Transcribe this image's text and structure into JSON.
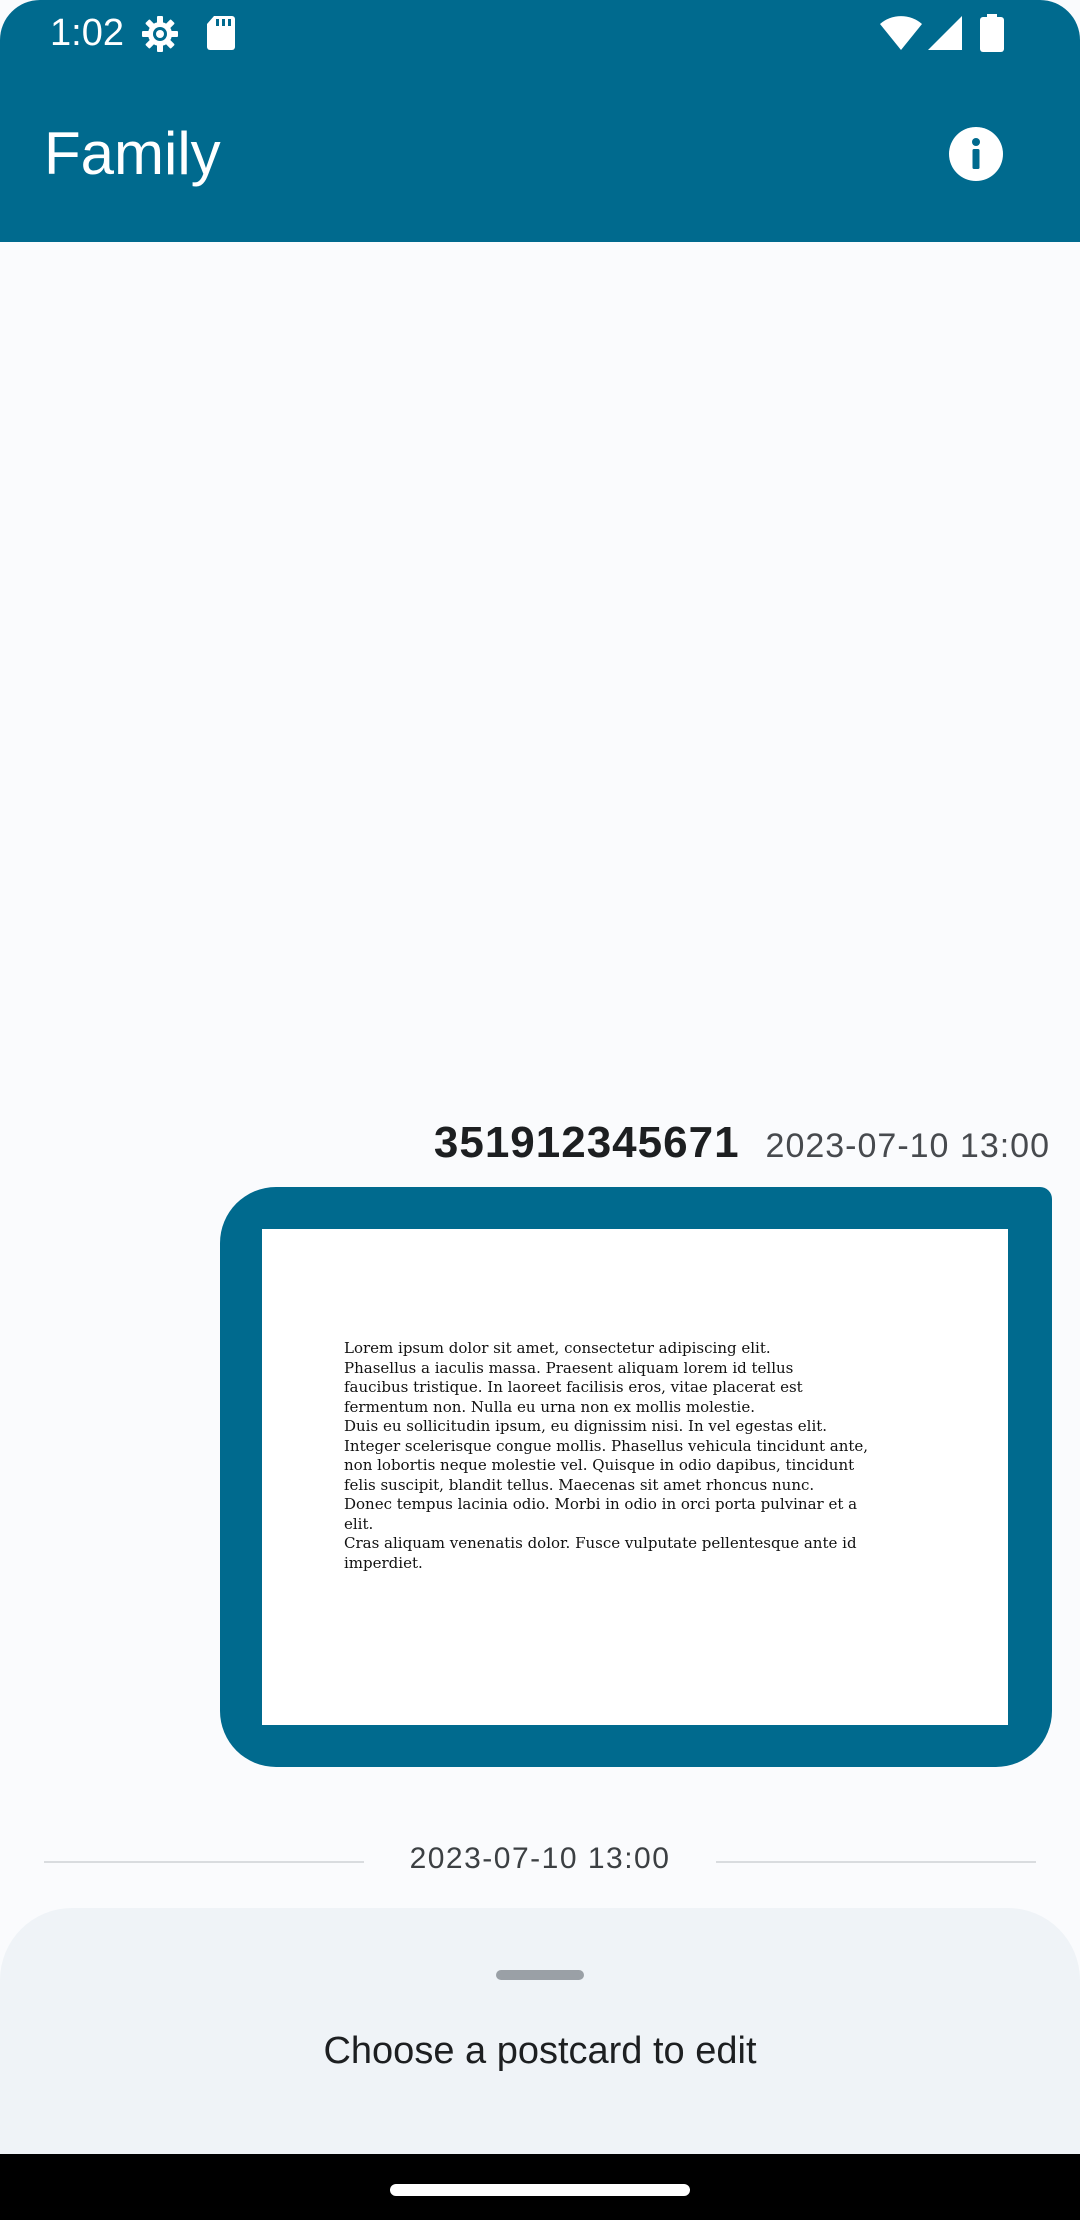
{
  "status_bar": {
    "time": "1:02",
    "icons": [
      "settings-gear-icon",
      "sd-card-icon",
      "wifi-icon",
      "signal-icon",
      "battery-icon"
    ]
  },
  "app_bar": {
    "title": "Family",
    "info_icon": "info-icon",
    "color": "#006a8e"
  },
  "message": {
    "sender": "351912345671",
    "timestamp": "2023-07-10 13:00",
    "postcard_text": [
      "Lorem ipsum dolor sit amet, consectetur adipiscing elit.",
      "Phasellus a iaculis massa. Praesent aliquam lorem id tellus",
      "faucibus tristique. In laoreet facilisis eros, vitae placerat est",
      "fermentum non. Nulla eu urna non ex mollis molestie.",
      "Duis eu sollicitudin ipsum, eu dignissim nisi. In vel egestas elit.",
      "Integer scelerisque congue mollis. Phasellus vehicula tincidunt ante,",
      "non lobortis neque molestie vel. Quisque in odio dapibus, tincidunt",
      "felis suscipit, blandit tellus. Maecenas sit amet rhoncus nunc.",
      "Donec tempus lacinia odio. Morbi in odio in orci porta pulvinar et a",
      "elit.",
      "Cras aliquam venenatis dolor. Fusce vulputate pellentesque ante id",
      "imperdiet."
    ]
  },
  "date_divider": {
    "label": "2023-07-10 13:00"
  },
  "bottom_sheet": {
    "text": "Choose a postcard to edit"
  }
}
